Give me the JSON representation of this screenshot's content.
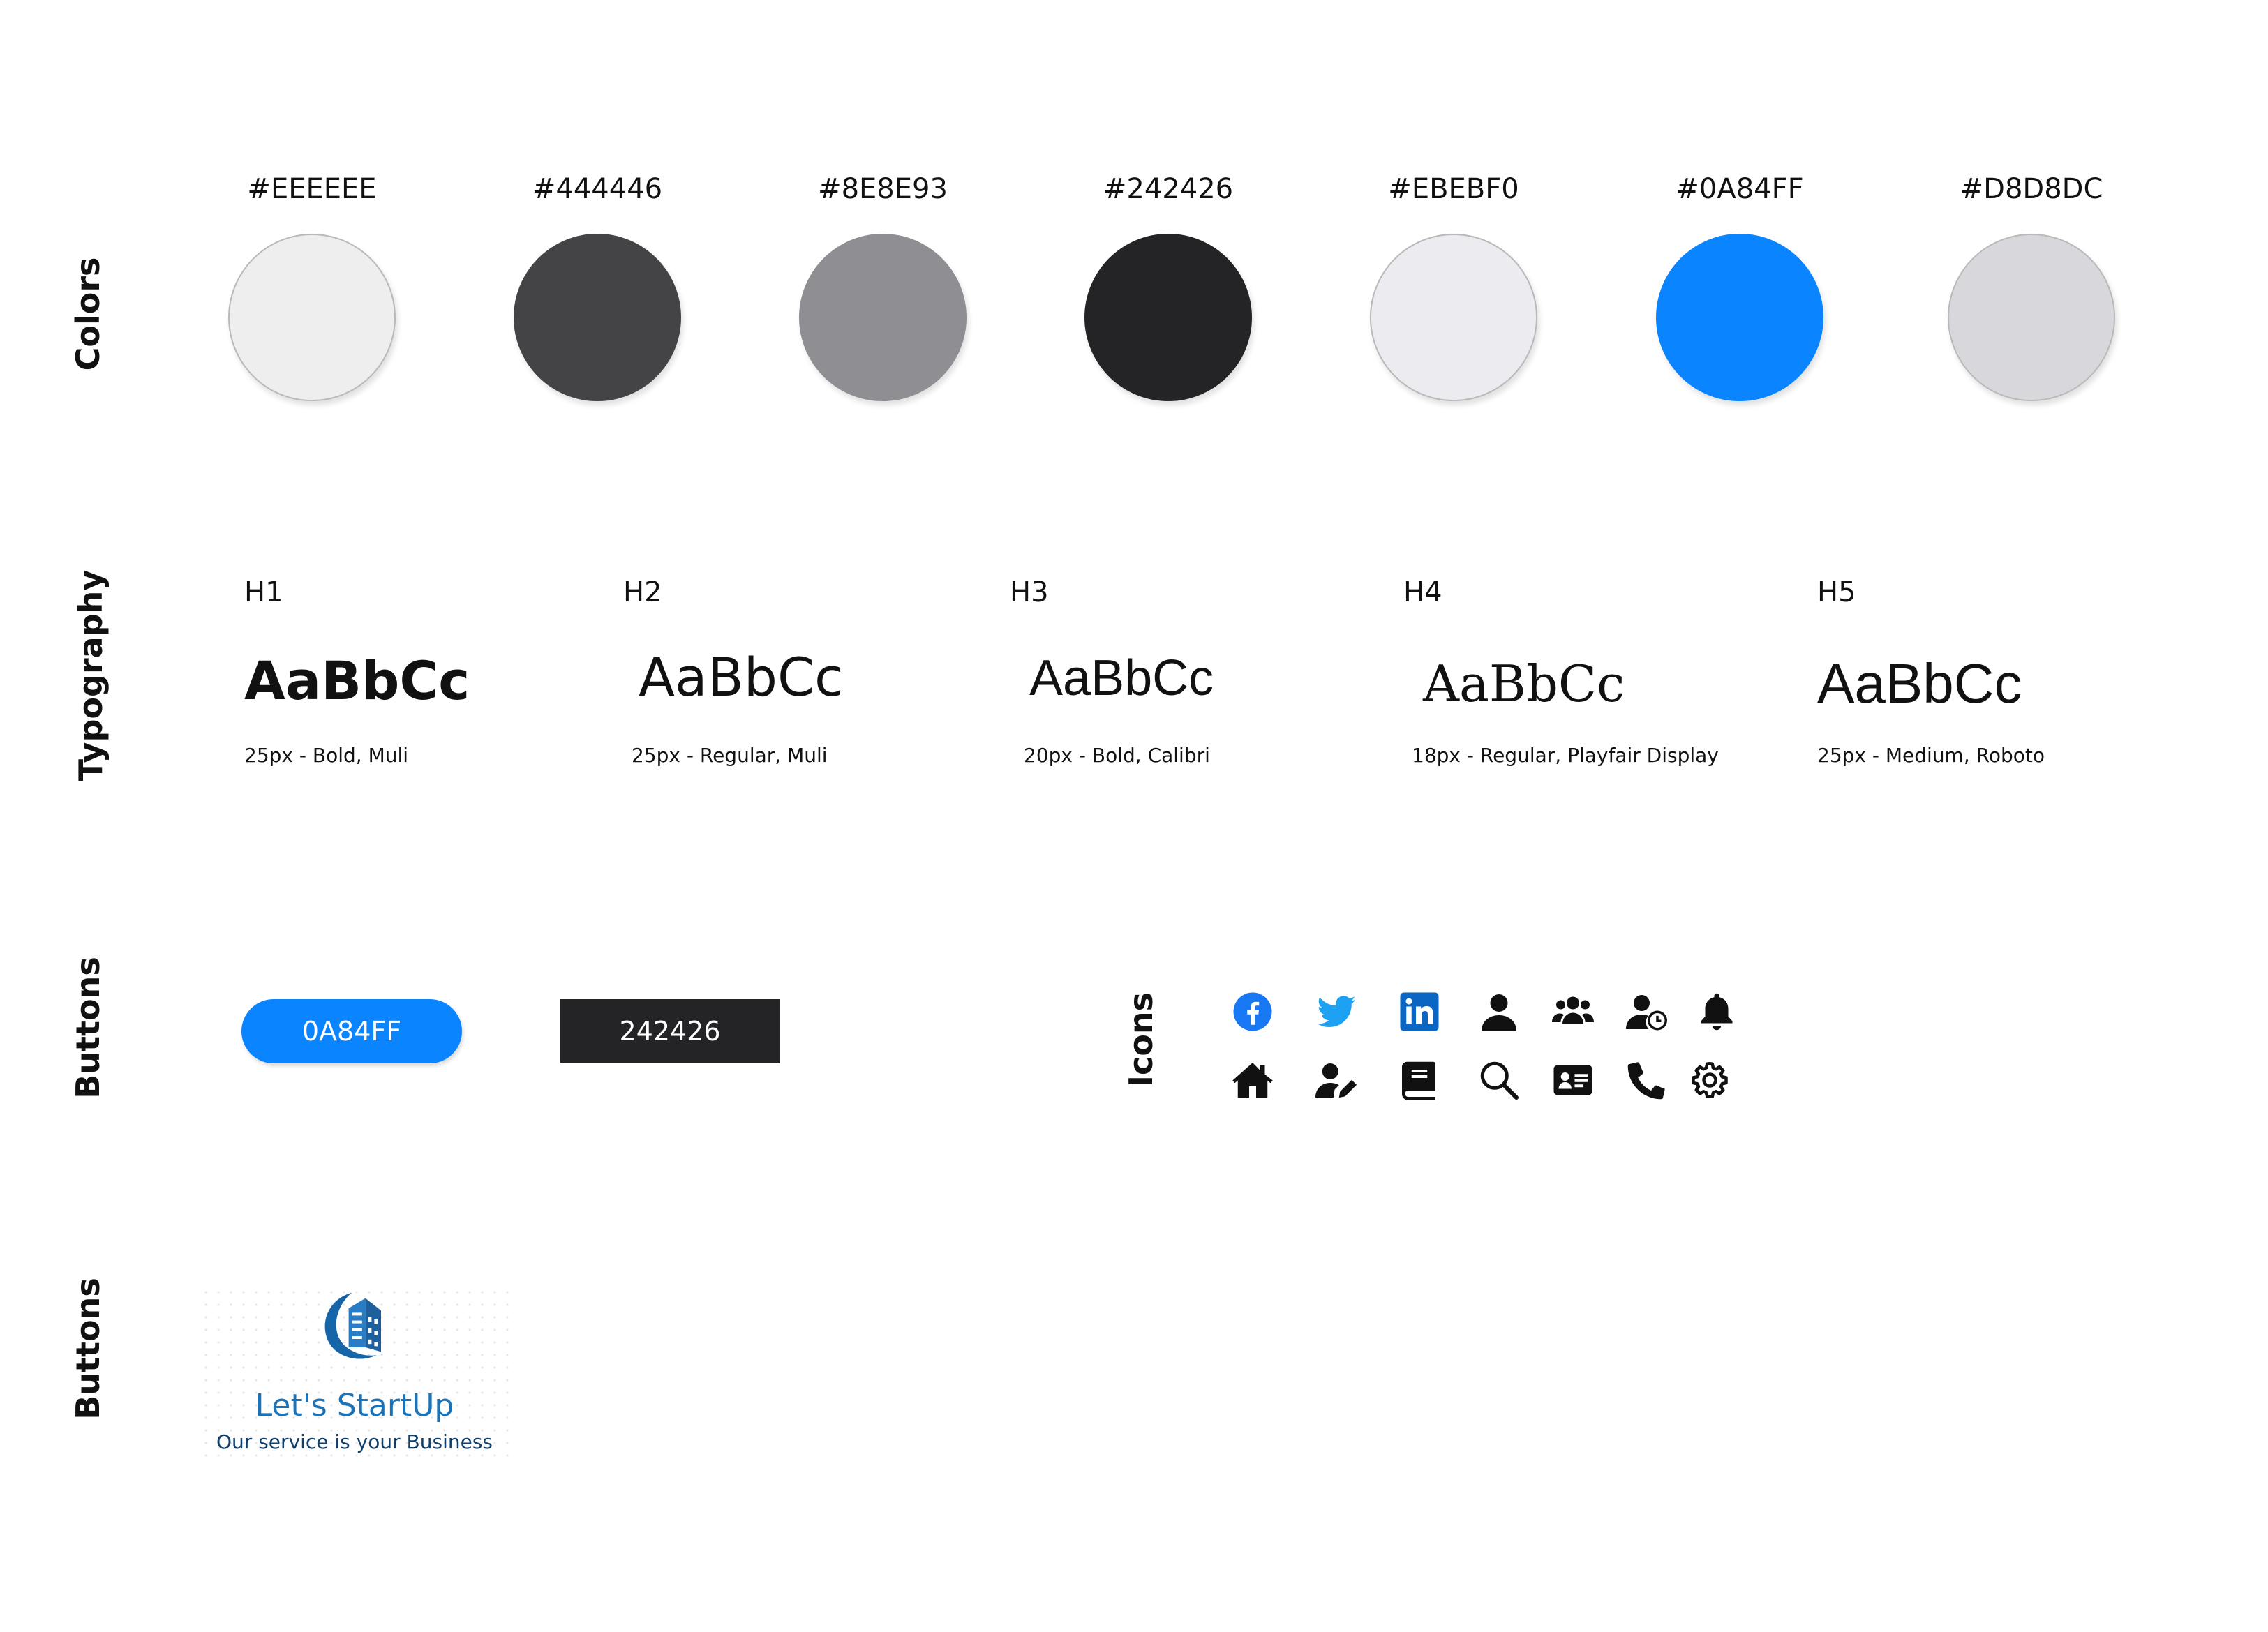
{
  "sections": {
    "colors": "Colors",
    "typography": "Typography",
    "buttons": "Buttons",
    "icons": "Icons",
    "logo": "Buttons"
  },
  "colors": [
    {
      "hex": "#EEEEEE",
      "value": "#EEEEEE"
    },
    {
      "hex": "#444446",
      "value": "#444446"
    },
    {
      "hex": "#8E8E93",
      "value": "#8E8E93"
    },
    {
      "hex": "#242426",
      "value": "#242426"
    },
    {
      "hex": "#EBEBF0",
      "value": "#EBEBF0"
    },
    {
      "hex": "#0A84FF",
      "value": "#0A84FF"
    },
    {
      "hex": "#D8D8DC",
      "value": "#D8D8DC"
    }
  ],
  "typography": [
    {
      "label": "H1",
      "sample": "AaBbCc",
      "spec": "25px - Bold, Muli"
    },
    {
      "label": "H2",
      "sample": "AaBbCc",
      "spec": "25px - Regular, Muli"
    },
    {
      "label": "H3",
      "sample": "AaBbCc",
      "spec": "20px - Bold, Calibri"
    },
    {
      "label": "H4",
      "sample": "AaBbCc",
      "spec": "18px - Regular, Playfair Display"
    },
    {
      "label": "H5",
      "sample": "AaBbCc",
      "spec": "25px - Medium, Roboto"
    }
  ],
  "buttons": [
    {
      "label": "0A84FF",
      "color": "#0A84FF"
    },
    {
      "label": "242426",
      "color": "#242426"
    }
  ],
  "icons": {
    "row1": [
      "facebook-icon",
      "twitter-icon",
      "linkedin-icon",
      "user-icon",
      "users-icon",
      "user-clock-icon",
      "bell-icon"
    ],
    "row2": [
      "home-icon",
      "user-edit-icon",
      "book-icon",
      "search-icon",
      "id-card-icon",
      "phone-icon",
      "gear-icon"
    ]
  },
  "logo": {
    "name": "Let's StartUp",
    "tagline": "Our service is your Business"
  }
}
